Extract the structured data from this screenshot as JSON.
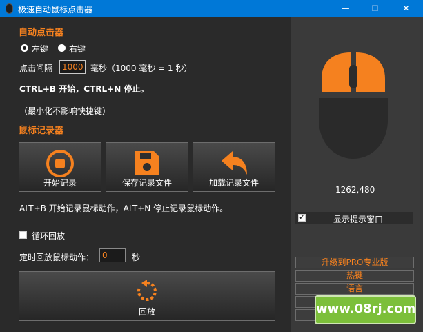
{
  "window": {
    "title": "极速自动鼠标点击器",
    "minimize_glyph": "—",
    "maximize_glyph": "☐",
    "close_glyph": "✕"
  },
  "clicker": {
    "section_title": "自动点击器",
    "radio_left": "左键",
    "radio_right": "右键",
    "selected_button": "left",
    "interval_label": "点击间隔",
    "interval_value": "1000",
    "interval_unit": "毫秒（1000 毫秒 = 1 秒）",
    "hotkey_text": "CTRL+B 开始，CTRL+N 停止。",
    "minimize_note": "（最小化不影响快捷键）"
  },
  "recorder": {
    "section_title": "鼠标记录器",
    "start_label": "开始记录",
    "save_label": "保存记录文件",
    "load_label": "加载记录文件",
    "hotkey_text": "ALT+B 开始记录鼠标动作，ALT+N 停止记录鼠标动作。",
    "loop_label": "循环回放",
    "loop_checked": false,
    "timed_label": "定时回放鼠标动作：",
    "timed_value": "0",
    "timed_unit": "秒",
    "playback_label": "回放"
  },
  "sidebar": {
    "coords": "1262,480",
    "show_tip_label": "显示提示窗口",
    "show_tip_checked": true,
    "upgrade_label": "升级到PRO专业版",
    "hotkey_label": "热键",
    "language_label": "语言"
  },
  "watermark": {
    "text": "www.08rj.com"
  },
  "colors": {
    "accent": "#f5811f",
    "titlebar": "#0078d7",
    "left_bg": "#2a2a2a",
    "right_bg": "#3a3a3a"
  }
}
